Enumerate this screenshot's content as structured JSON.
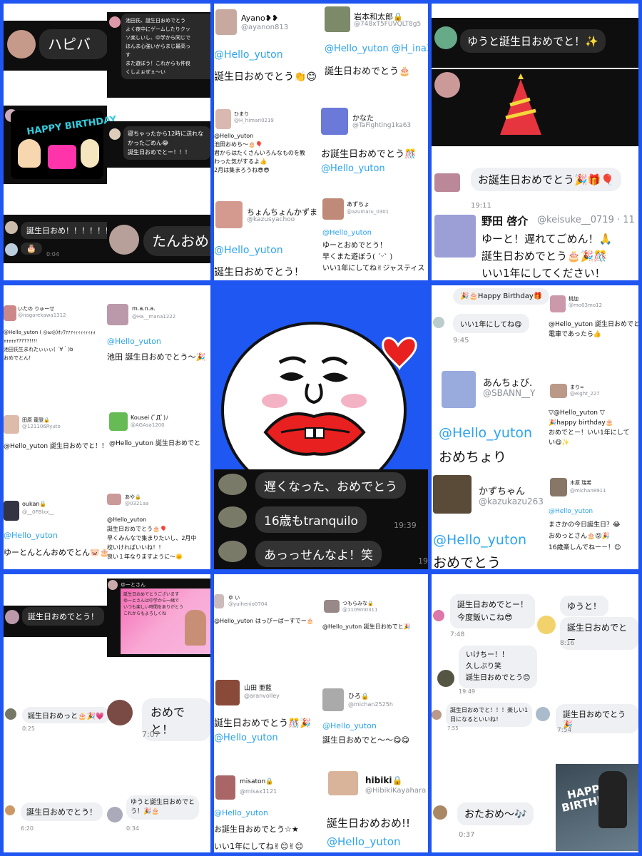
{
  "colors": {
    "border": "#1f55f0",
    "mention": "#2aa3ef",
    "dark_bubble": "#2a2a2a",
    "light_bubble": "#eef0f3"
  },
  "p1": {
    "b1": "ハピバ",
    "b2": "池田氏、誕生日おめでとう\nよく夜中にゲームしたりクッ\nソ楽しいし、中学から同じで\nほんま心強いからまじ最高っ\nす\nまた遊ぼう！これからも仲良\nくしよぉぜぇ〜い",
    "card": "HAPPY BIRTHDAY",
    "b3": "寝ちゃったから12時に送れな\nかったごめん😂\n誕生日おめでとー！！！",
    "b4": "誕生日おめ！！！！！！",
    "b5": "たんおめ",
    "cake": "🎂",
    "t1": "0:04"
  },
  "p2": {
    "u1_name": "Ayano❥❥",
    "u1_handle": "@ayanon813",
    "u1_m": "@Hello_yuton",
    "u1_t": "誕生日おめでとう👏😊",
    "u2_name": "岩本和太郎🔒",
    "u2_handle": "@748xT5FUVQLT8g5",
    "u2_m": "@Hello_yuton @H_ina31",
    "u2_t": "誕生日おめでとう🎂",
    "u3_name": "ひまり",
    "u3_handle": "@H_himari0219",
    "u3_t": "@Hello_yuton\n池田おめち〜🎂🎈\n君からはたくさんいろんなものを教\nわった気がするよ👍\n2月は集まろうね😎😎",
    "u4_name": "かなた",
    "u4_handle": "@TaFighting1ka63",
    "u4_t": "お誕生日おめでとう🎊",
    "u4_m": "@Hello_yuton",
    "u5_name": "ちょんちょんかずま",
    "u5_handle": "@kazusyachoo",
    "u5_m": "@Hello_yuton",
    "u5_t": "誕生日おめでとう！",
    "u6_name": "あずちょ",
    "u6_handle": "@azumaru_0301",
    "u6_m": "@Hello_yuton",
    "u6_t": "ゆーとおめでとう！\n早くまた遊ぼう( ˊᵕˋ )\nいい1年にしてね✌ジャスティス"
  },
  "p3": {
    "b1": "ゆうと誕生日おめでと！✨",
    "b2": "お誕生日おめでとう🎉🎁🎈",
    "time": "19:11",
    "name": "野田 啓介",
    "handle": "@keisuke__0719 · 11",
    "t": "ゆーと！遅れてごめん！🙏\n誕生日おめでとう🎂🎉🎊\nいい1年にしてください！"
  },
  "p4": {
    "u1_name": "いたの りゅーせ",
    "u1_handle": "@nagarekawa1312",
    "u1_t": "@Hello_yuton ( ◎ω◎)ｵｯﾜｧｧｧｨｨｨｨｨｨｨｫｫ\nｫｫｫｫｫ?????!!!!\n池田氏生まれたぃぃぃ( ´∀｀)b\nおめでとん！",
    "u2_name": "m.a.n.a.",
    "u2_handle": "@Ha__mana1222",
    "u2_m": "@Hello_yuton",
    "u2_t": "池田 誕生日おめでとう〜🎉",
    "u3_name": "田原 龍登🔒",
    "u3_handle": "@121106Ryuto",
    "u3_t": "@Hello_yuton 誕生日おめでと！！",
    "u4_name": "Kousei (ﾟДﾟ)ﾉ",
    "u4_handle": "@AGAsa1200",
    "u4_t": "@Hello_yuton 誕生日おめでと",
    "u5_name": "oukan🔒",
    "u5_handle": "@__0FBlxx__",
    "u5_m": "@Hello_yuton",
    "u5_t": "ゆーとんとんおめでとん🐷🎂",
    "u6_name": "あや🔒",
    "u6_handle": "@0321aa",
    "u6_t": "@Hello_yuton\n誕生日おめでとう🎂🎈\n早くみんなで集まりたいし、2月中\n校いければいいね！！\n良い１年なりますように〜🌞"
  },
  "p5": {
    "b1": "遅くなった、おめでとう",
    "b2": "16歳もtranquilo",
    "b3": "あっっせんなよ！笑",
    "time": "19:39",
    "time2": "19"
  },
  "p6": {
    "b1": "🎉🎂Happy Birthday🎁",
    "b2": "いい1年にしてね😋",
    "time1": "9:45",
    "u1_name": "桃加",
    "u1_handle": "@mo03mo12",
    "u1_t": "@Hello_yuton 誕生日おめでと\n電車であったら👍",
    "u2_name": "あんちょび.",
    "u2_handle": "@SBANN__Y",
    "u2_m": "@Hello_yuton",
    "u2_t": "おめちょり",
    "u3_name": "まり∞",
    "u3_handle": "@eight_227",
    "u3_t": "▽@Hello_yuton ▽\n🎉happy birthday🎂\nおめでとー！いい1年にして\nい😋✨",
    "u4_name": "かずちゃん",
    "u4_handle": "@kazukazu263",
    "u4_m": "@Hello_yuton",
    "u4_t": "おめでとう",
    "u5_name": "木原 瑞希",
    "u5_handle": "@michan8911",
    "u5_m": "@Hello_yuton",
    "u5_t": "まさかの今日誕生日？😂\nおめっとさん🎂😜🎉\n16歳楽しんでねー－！😊"
  },
  "p7": {
    "b1": "誕生日おめでとう！",
    "name": "ゆーとさん",
    "card": "誕生日おめでとうございます\nゆーとさんは中学から一緒で\nいつも楽しい時間をありがとう\nこれからもよろしくね",
    "b2": "誕生日おめっと🎂🎉💗",
    "t1": "0:25",
    "b3": "おめでと！",
    "t2": "7:07",
    "b4": "誕生日おめでとう！",
    "t3": "6:20",
    "b5": "ゆうと誕生日おめでと\nう！🎉🎂",
    "t4": "0:34"
  },
  "p8": {
    "u1_name": "ゆ い",
    "u1_handle": "@yuihenio0704",
    "u1_t": "@Hello_yuton はっぴーばーすでー🎂",
    "u2_name": "つもらみな🔒",
    "u2_handle": "@1109m0311",
    "u2_t": "@Hello_yuton 誕生日おめでと🎉",
    "u3_name": "山田 亜藍",
    "u3_handle": "@aranvolley",
    "u3_t": "誕生日おめでとう🎊🎉",
    "u3_m": "@Hello_yuton",
    "u4_name": "ひろ🔒",
    "u4_handle": "@michan2525h",
    "u4_m": "@Hello_yuton",
    "u4_t": "誕生日おめでと〜〜😋😋",
    "u5_name": "misaton🔒",
    "u5_handle": "@misax1121",
    "u5_m": "@Hello_yuton",
    "u5_t": "お誕生日おめでとう☆★\nいい1年にしてね✌😊✌😊",
    "u6_name": "hibiki🔒",
    "u6_handle": "@HibikiKayahara",
    "u6_t": "誕生日おめおめ!!",
    "u6_m": "@Hello_yuton"
  },
  "p9": {
    "b1": "誕生日おめでとー！\n今度飯いこね😎",
    "t1": "7:48",
    "b2": "ゆうと！",
    "b3": "誕生日おめでとー",
    "t2": "8:16",
    "b4": "いけちー！！\n久しぶり笑\n誕生日おめでとう😊",
    "t3": "19:49",
    "b5": "誕生日おめでと！！！楽しい1\n日になるといいね！",
    "t4": "7:55",
    "b6": "誕生日おめでとう🎉",
    "t5": "7:54",
    "photo": "HAPPY BIRTHDAY",
    "b7": "おたおめ〜🎶",
    "t6": "0:37"
  }
}
